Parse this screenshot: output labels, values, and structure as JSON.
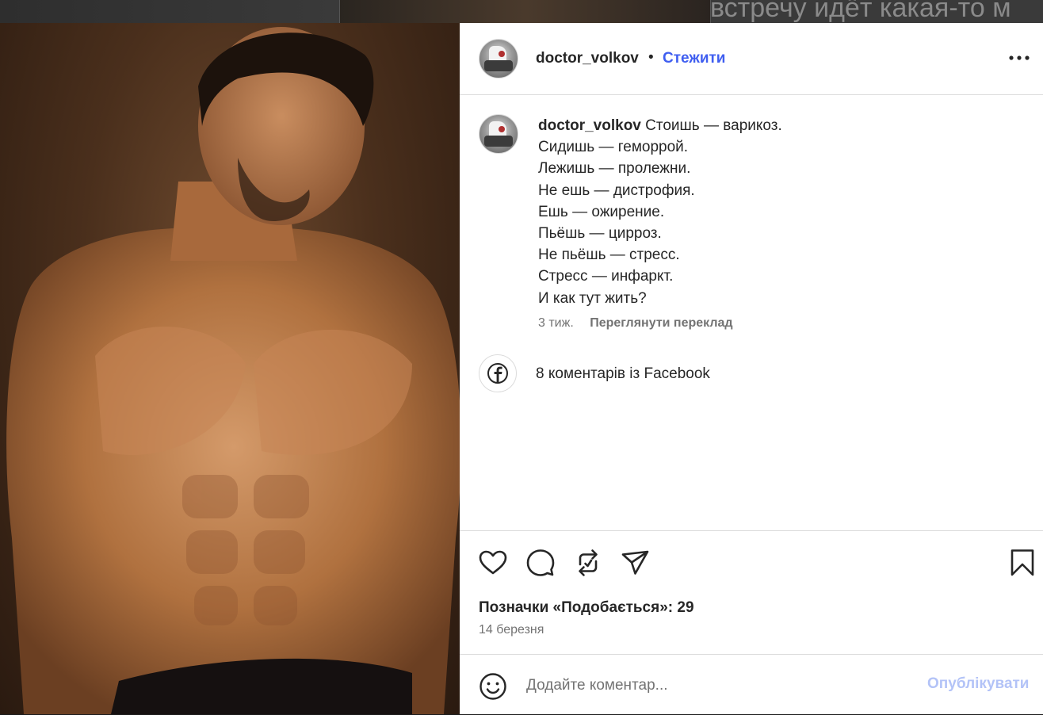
{
  "background": {
    "text": "встречу идёт какая-то м"
  },
  "post": {
    "author": "doctor_volkov",
    "separator": "•",
    "follow_label": "Стежити",
    "more_icon": "more-horizontal-icon",
    "caption_lines": [
      "Стоишь — варикоз.",
      "Сидишь — геморрой.",
      "Лежишь — пролежни.",
      "Не ешь — дистрофия.",
      "Ешь — ожирение.",
      "Пьёшь — цирроз.",
      "Не пьёшь — стресс.",
      "Стресс — инфаркт.",
      "И как тут жить?"
    ],
    "time": "3 тиж.",
    "translate_label": "Переглянути переклад",
    "facebook_comments": "8 коментарів із Facebook",
    "likes_label": "Позначки «Подобається»: 29",
    "date": "14 березня"
  },
  "actions": {
    "like_icon": "heart-icon",
    "comment_icon": "comment-icon",
    "repost_icon": "repost-icon",
    "share_icon": "send-icon",
    "save_icon": "bookmark-icon"
  },
  "comment_box": {
    "placeholder": "Додайте коментар...",
    "publish_label": "Опублікувати"
  },
  "colors": {
    "accent": "#3f5ef0",
    "publish_disabled": "#b3c3f7",
    "text_primary": "#262626",
    "text_secondary": "#737373",
    "border": "#dbdbdb"
  }
}
